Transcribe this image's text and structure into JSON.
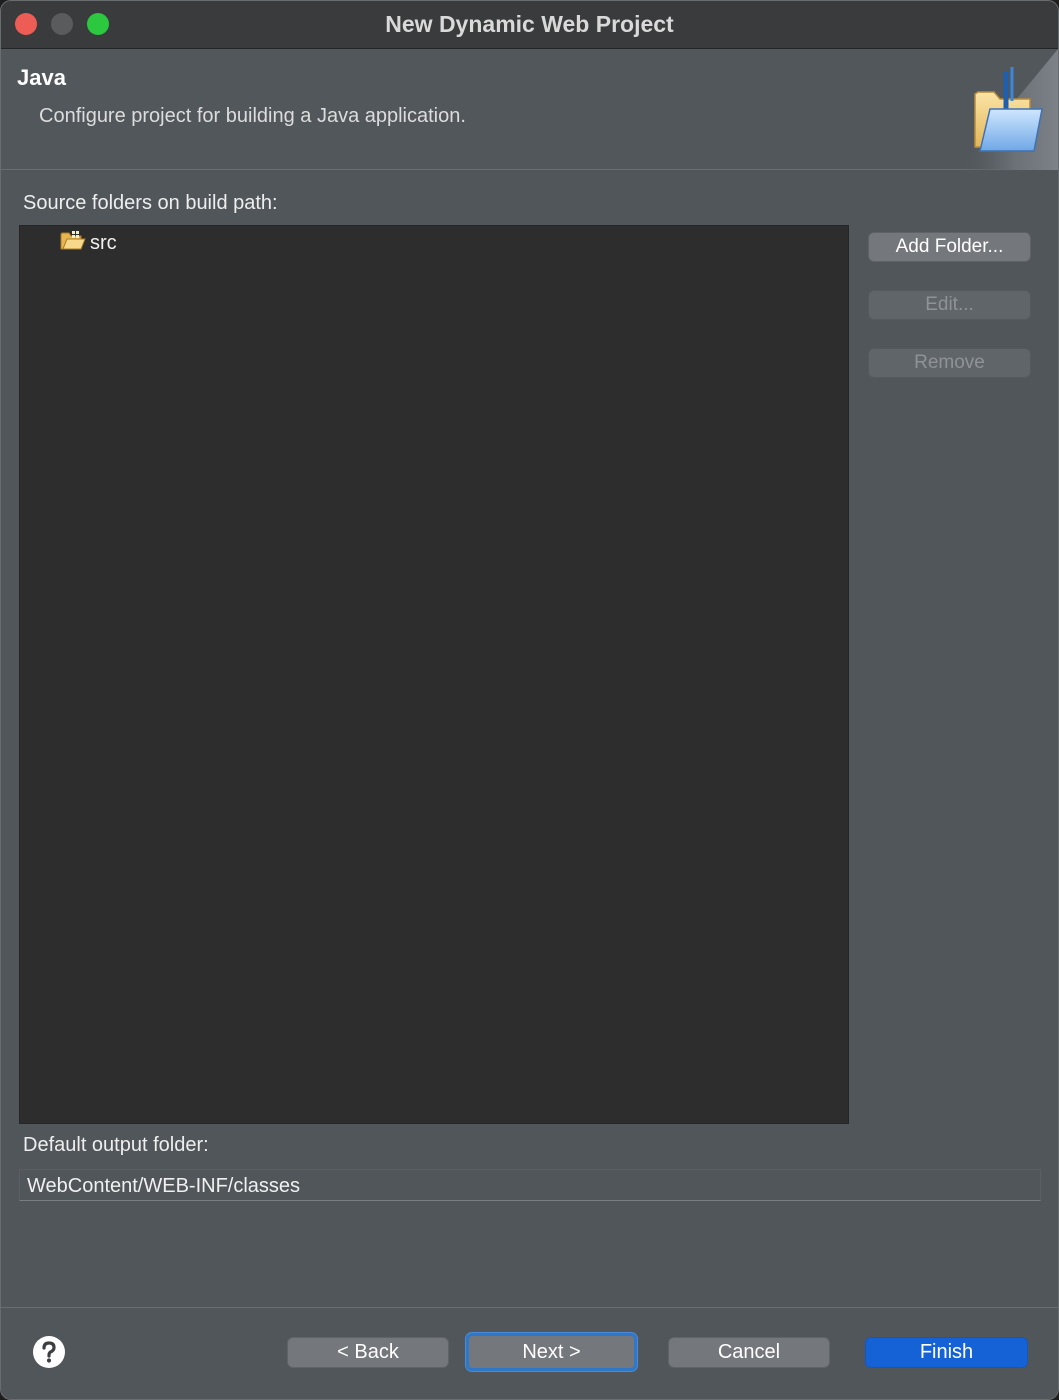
{
  "window": {
    "title": "New Dynamic Web Project"
  },
  "banner": {
    "title": "Java",
    "description": "Configure project for building a Java application.",
    "image_icon": "java-folder-wizard-icon"
  },
  "source_folders": {
    "label": "Source folders on build path:",
    "items": [
      {
        "label": "src",
        "icon": "source-folder-icon"
      }
    ],
    "buttons": {
      "add_folder": "Add Folder...",
      "edit": "Edit...",
      "remove": "Remove"
    }
  },
  "output_folder": {
    "label": "Default output folder:",
    "value": "WebContent/WEB-INF/classes"
  },
  "footer": {
    "help_icon": "help-icon",
    "back": "< Back",
    "next": "Next >",
    "cancel": "Cancel",
    "finish": "Finish"
  },
  "colors": {
    "close": "#ee5c56",
    "minimize": "#5a5b5d",
    "maximize": "#2bc840",
    "primary_button": "#1561d6",
    "focus_ring": "#2f77c8"
  }
}
